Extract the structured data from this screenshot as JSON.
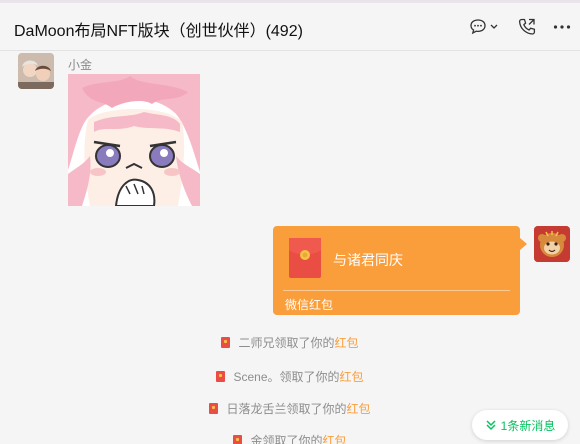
{
  "header": {
    "title": "DaMoon布局NFT版块（创世伙伴）(492)",
    "icons": {
      "chat": "chat-bubble-icon",
      "call": "phone-call-icon",
      "more": "more-dots-icon"
    }
  },
  "messages": {
    "incoming": {
      "sender": "小金",
      "type": "sticker",
      "sticker_icon": "anime-girl-sticker"
    },
    "outgoing": {
      "type": "red-packet",
      "title": "与诸君同庆",
      "footer": "微信红包"
    }
  },
  "notices": [
    {
      "prefix": "二师兄领取了你的",
      "highlight": "红包"
    },
    {
      "prefix": "Scene。领取了你的",
      "highlight": "红包"
    },
    {
      "prefix": "日落龙舌兰领取了你的",
      "highlight": "红包"
    },
    {
      "prefix": "金领取了你的",
      "highlight": "红包"
    }
  ],
  "new_message_pill": {
    "label": "1条新消息"
  },
  "colors": {
    "background": "#f5f5f5",
    "red_packet": "#fa9d3b",
    "red_packet_envelope": "#e94d43",
    "highlight": "#fa9d3b",
    "new_message": "#07c160"
  }
}
